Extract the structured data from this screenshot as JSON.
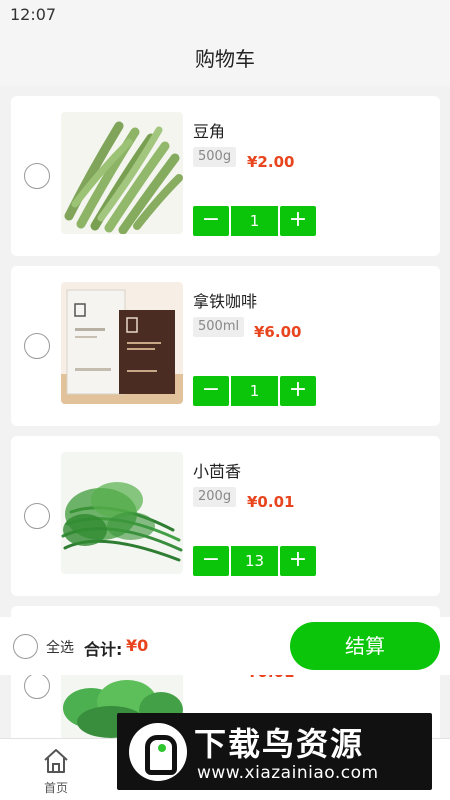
{
  "status": {
    "time": "12:07"
  },
  "header": {
    "title": "购物车"
  },
  "items": [
    {
      "name": "豆角",
      "spec": "500g",
      "price": "¥2.00",
      "qty": "1",
      "minus": "−",
      "plus": "+"
    },
    {
      "name": "拿铁咖啡",
      "spec": "500ml",
      "price": "¥6.00",
      "qty": "1",
      "minus": "−",
      "plus": "+"
    },
    {
      "name": "小茴香",
      "spec": "200g",
      "price": "¥0.01",
      "qty": "13",
      "minus": "−",
      "plus": "+"
    },
    {
      "name": "",
      "spec": "",
      "price": "¥0.01",
      "qty": "",
      "minus": "",
      "plus": ""
    }
  ],
  "footer": {
    "select_all": "全选",
    "total_label": "合计:",
    "total_value": "¥0",
    "checkout": "结算"
  },
  "tabs": [
    {
      "label": "首页",
      "icon": "home-icon"
    },
    {
      "label": "",
      "icon": "category-icon"
    },
    {
      "label": "",
      "icon": "cart-icon"
    },
    {
      "label": "",
      "icon": "user-icon"
    }
  ],
  "watermark": {
    "title": "下载鸟资源",
    "url": "www.xiazainiao.com"
  },
  "colors": {
    "accent": "#0ac50a",
    "price": "#e8451e",
    "background": "#f2f2f2"
  }
}
